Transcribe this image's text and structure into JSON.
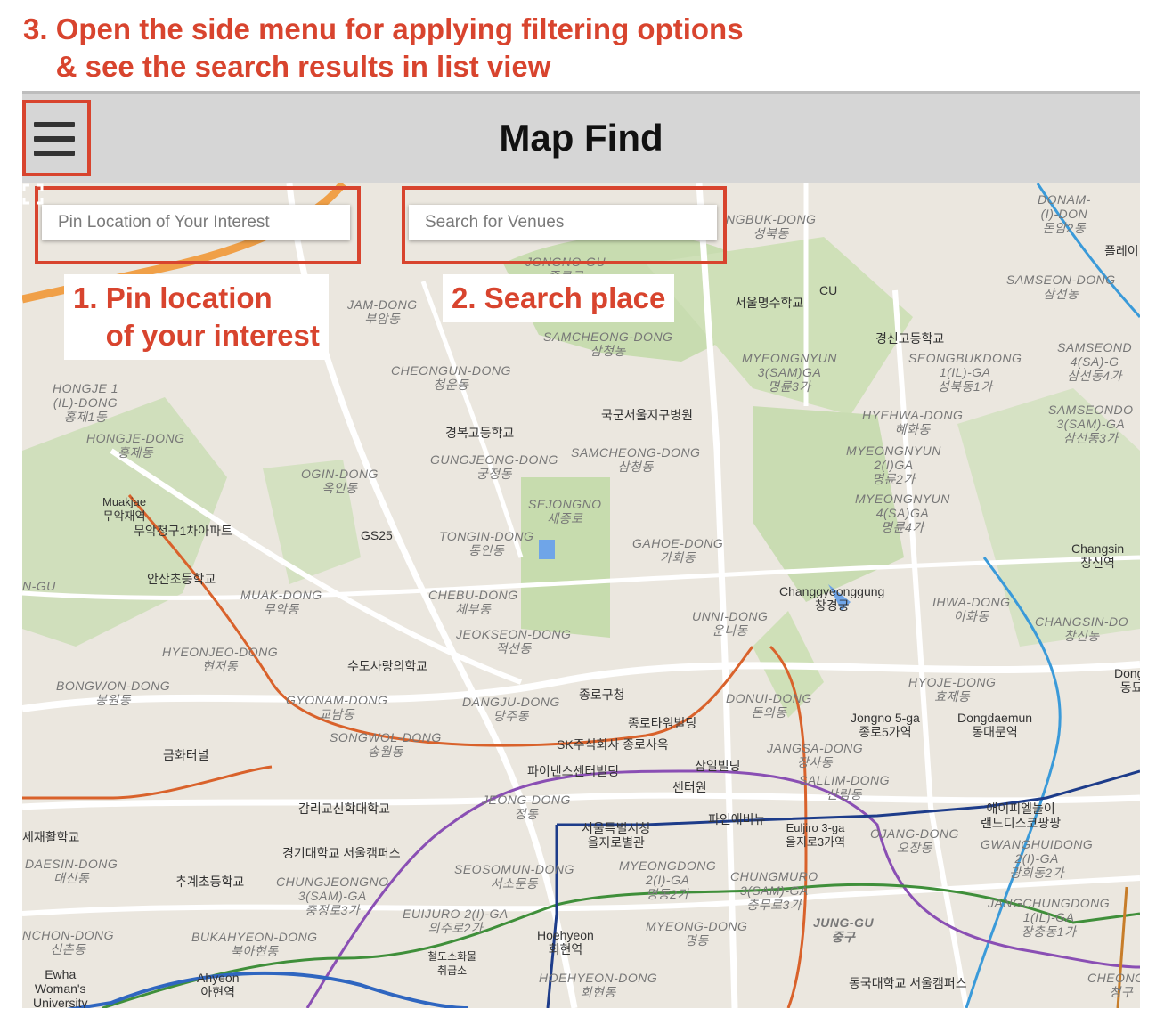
{
  "caption": "3. Open the side menu for applying filtering options\n    & see the search results in list view",
  "app": {
    "title": "Map Find"
  },
  "search": {
    "pin_placeholder": "Pin Location of Your Interest",
    "venue_placeholder": "Search for Venues"
  },
  "callouts": {
    "pin": "1. Pin location\n    of your interest",
    "search": "2. Search place"
  },
  "colors": {
    "annotation": "#d8442e",
    "app_bar": "#d6d6d6"
  },
  "map_labels": [
    "DONAM-\n(I)-DON\n돈암2동",
    "NGBUK-DONG\n성북동",
    "플레이",
    "CU",
    "서울명수학교",
    "SAMSEON-DONG\n삼선동",
    "JAM-DONG\n부암동",
    "SAMCHEONG-DONG\n삼청동",
    "경신고등학교",
    "MYEONGNYUN\n3(SAM)GA\n명륜3가",
    "SEONGBUKDONG\n1(IL)-GA\n성북동1가",
    "SAMSEOND\n4(SA)-G\n삼선동4가",
    "CHEONGUN-DONG\n청운동",
    "HONGJE 1\n(IL)-DONG\n홍제1동",
    "국군서울지구병원",
    "HYEHWA-DONG\n혜화동",
    "SAMSEONDO\n3(SAM)-GA\n삼선동3가",
    "HONGJE-DONG\n홍제동",
    "경복고등학교",
    "GUNGJEONG-DONG\n궁정동",
    "SAMCHEONG-DONG\n삼청동",
    "MYEONGNYUN\n2(I)GA\n명륜2가",
    "OGIN-DONG\n옥인동",
    "SEJONGNO\n세종로",
    "MYEONGNYUN\n4(SA)GA\n명륜4가",
    "Muakjae\n무악재역",
    "무악청구1차아파트",
    "GS25",
    "TONGIN-DONG\n통인동",
    "GAHOE-DONG\n가회동",
    "Changsin\n창신역",
    "N-GU",
    "안산초등학교",
    "Changgyeonggung\n창경궁",
    "MUAK-DONG\n무악동",
    "CHEBU-DONG\n체부동",
    "IHWA-DONG\n이화동",
    "UNNI-DONG\n운니동",
    "JEOKSEON-DONG\n적선동",
    "CHANGSIN-DO\n창신동",
    "HYEONJEO-DONG\n현저동",
    "수도사랑의학교",
    "BONGWON-DONG\n봉원동",
    "GYONAM-DONG\n교남동",
    "DANGJU-DONG\n당주동",
    "종로구청",
    "DONUI-DONG\n돈의동",
    "HYOJE-DONG\n효제동",
    "Dongmy\n동묘앞",
    "종로타워빌딩",
    "Jongno 5-ga\n종로5가역",
    "Dongdaemun\n동대문역",
    "SONGWOL-DONG\n송월동",
    "SK주식회사 종로사옥",
    "금화터널",
    "JANGSA-DONG\n장사동",
    "파이낸스센터빌딩",
    "삼일빌딩",
    "SALLIM-DONG\n산림동",
    "센터원",
    "JEONG-DONG\n정동",
    "감리교신학대학교",
    "애이피엘놀이\n랜드디스코팡팡",
    "서울특별시청\n을지로별관",
    "파인애비뉴",
    "Euljiro 3-ga\n을지로3가역",
    "OJANG-DONG\n오장동",
    "세재활학교",
    "GWANGHUIDONG\n2(I)-GA\n광희동2가",
    "경기대학교 서울캠퍼스",
    "DAESIN-DONG\n대신동",
    "SEOSOMUN-DONG\n서소문동",
    "MYEONGDONG\n2(I)-GA\n명동2가",
    "추계초등학교",
    "CHUNGJEONGNO\n3(SAM)-GA\n충정로3가",
    "CHUNGMURO\n3(SAM)-GA\n충무로3가",
    "JANGCHUNGDONG\n1(IL)-GA\n장충동1가",
    "EUIJURO 2(I)-GA\n의주로2가",
    "MYEONG-DONG\n명동",
    "JUNG-GU\n중구",
    "NCHON-DONG\n신촌동",
    "BUKAHYEON-DONG\n북아현동",
    "Hoehyeon\n회현역",
    "철도소화물\n취급소",
    "Ewha\nWoman's\nUniversity",
    "Ahyeon\n아현역",
    "HOEHYEON-DONG\n회현동",
    "동국대학교 서울캠퍼스",
    "CHEONGG\n청구",
    "JONGNO-GU\n종로구"
  ]
}
